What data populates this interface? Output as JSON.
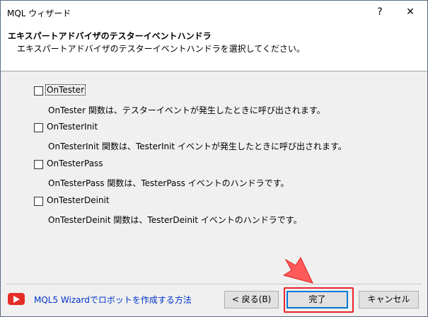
{
  "window": {
    "title": "MQL ウィザード",
    "help_glyph": "?",
    "close_glyph": "✕"
  },
  "header": {
    "title": "エキスパートアドバイザのテスターイベントハンドラ",
    "subtitle": "エキスパートアドバイザのテスターイベントハンドラを選択してください。"
  },
  "options": [
    {
      "label": "OnTester",
      "checked": false,
      "description": "OnTester 関数は、テスターイベントが発生したときに呼び出されます。"
    },
    {
      "label": "OnTesterInit",
      "checked": false,
      "description": "OnTesterInit 関数は、TesterInit イベントが発生したときに呼び出されます。"
    },
    {
      "label": "OnTesterPass",
      "checked": false,
      "description": "OnTesterPass 関数は、TesterPass イベントのハンドラです。"
    },
    {
      "label": "OnTesterDeinit",
      "checked": false,
      "description": "OnTesterDeinit 関数は、TesterDeinit イベントのハンドラです。"
    }
  ],
  "footer": {
    "video_link": "MQL5 Wizardでロボットを作成する方法",
    "back_label": "< 戻る(B)",
    "finish_label": "完了",
    "cancel_label": "キャンセル"
  },
  "colors": {
    "highlight": "#e8232a",
    "link": "#0033cc",
    "youtube": "#e52d27"
  }
}
